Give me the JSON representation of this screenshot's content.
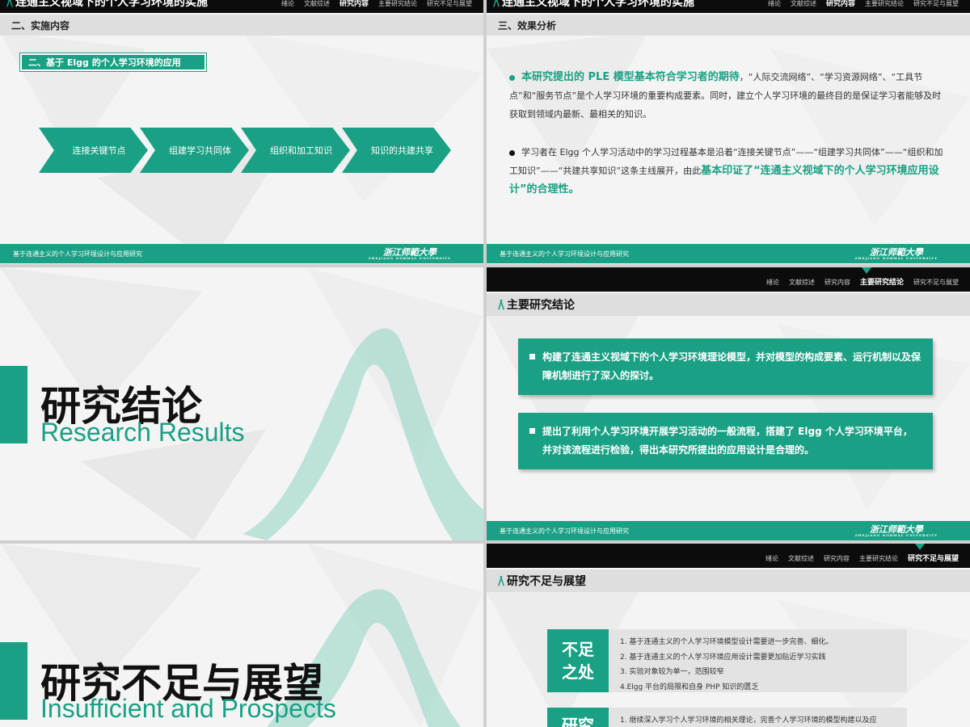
{
  "slide1": {
    "title_cut": "连通主义视域下的个人学习环境的实施",
    "nav": [
      "绪论",
      "文献综述",
      "研究内容",
      "主要研究结论",
      "研究不足与展望"
    ],
    "active_nav": 2,
    "section": "二、实施内容",
    "subtitle": "二、基于 Elgg 的个人学习环境的应用",
    "steps": [
      "连接关键节点",
      "组建学习共同体",
      "组织和加工知识",
      "知识的共建共享"
    ],
    "footer_text": "基于连通主义的个人学习环境设计与应用研究",
    "university": "浙江师範大學",
    "university_en": "ZHEJIANG NORMAL UNIVERSITY"
  },
  "slide2": {
    "title_cut": "连通主义视域下的个人学习环境的实施",
    "nav": [
      "绪论",
      "文献综述",
      "研究内容",
      "主要研究结论",
      "研究不足与展望"
    ],
    "active_nav": 2,
    "section": "三、效果分析",
    "p1_highlight": "本研究提出的 PLE 模型基本符合学习者的期待",
    "p1_rest": "，“人际交流网络”、“学习资源网络”、“工具节点”和“服务节点”是个人学习环境的重要构成要素。同时，建立个人学习环境的最终目的是保证学习者能够及时获取到领域内最新、最相关的知识。",
    "p2_start": "学习者在 Elgg 个人学习活动中的学习过程基本是沿着“连接关键节点”——“组建学习共同体”——“组织和加工知识”——“共建共享知识”这条主线展开，由此",
    "p2_highlight": "基本印证了“连通主义视域下的个人学习环境应用设计”的合理性。",
    "footer_text": "基于连通主义的个人学习环境设计与应用研究",
    "university": "浙江师範大學",
    "university_en": "ZHEJIANG NORMAL UNIVERSITY"
  },
  "slide3": {
    "title": "研究结论",
    "subtitle": "Research Results"
  },
  "slide4": {
    "nav": [
      "绪论",
      "文献综述",
      "研究内容",
      "主要研究结论",
      "研究不足与展望"
    ],
    "active_nav": 3,
    "heading": "主要研究结论",
    "box1": "构建了连通主义视域下的个人学习环境理论模型，并对模型的构成要素、运行机制以及保障机制进行了深入的探讨。",
    "box2": "提出了利用个人学习环境开展学习活动的一般流程，搭建了 Elgg 个人学习环境平台，并对该流程进行检验，得出本研究所提出的应用设计是合理的。",
    "footer_text": "基于连通主义的个人学习环境设计与应用研究",
    "university": "浙江师範大學",
    "university_en": "ZHEJIANG NORMAL UNIVERSITY"
  },
  "slide5": {
    "title": "研究不足与展望",
    "subtitle": "Insufficient and Prospects"
  },
  "slide6": {
    "nav": [
      "绪论",
      "文献综述",
      "研究内容",
      "主要研究结论",
      "研究不足与展望"
    ],
    "active_nav": 4,
    "heading": "研究不足与展望",
    "tag1": "不足之处",
    "list1": [
      "1. 基于连通主义的个人学习环境模型设计需要进一步完善、细化。",
      "2. 基于连通主义的个人学习环境应用设计需要更加贴近学习实践",
      "3. 实验对象较为单一，范围较窄",
      "4.Elgg 平台的局限和自身 PHP 知识的匮乏"
    ],
    "tag2": "研究",
    "list2": [
      "1. 继续深入学习个人学习环境的相关理论，完善个人学习环境的模型构建以及应"
    ]
  },
  "colors": {
    "accent": "#1aa084",
    "dark": "#0c0c0c",
    "section": "#dedede"
  }
}
